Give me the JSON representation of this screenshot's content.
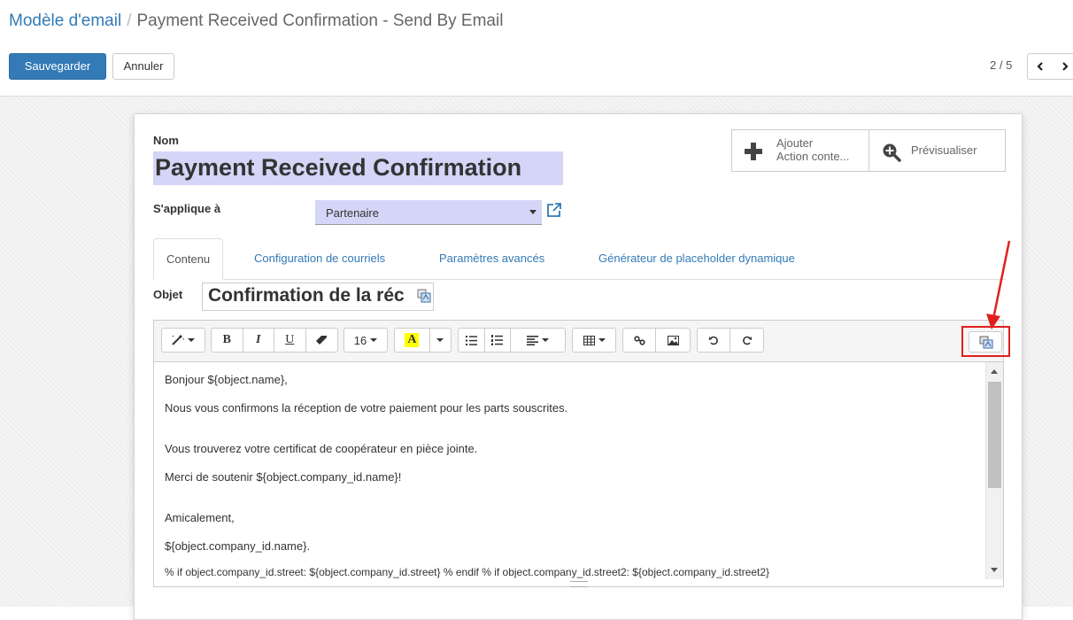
{
  "breadcrumb": {
    "parent": "Modèle d'email",
    "separator": "/",
    "current": "Payment Received Confirmation - Send By Email"
  },
  "actions": {
    "save_label": "Sauvegarder",
    "cancel_label": "Annuler"
  },
  "pager": {
    "value": "2 / 5"
  },
  "form": {
    "name_label": "Nom",
    "name_value": "Payment Received Confirmation",
    "smart_buttons": {
      "add_action_line1": "Ajouter",
      "add_action_line2": "Action conte...",
      "preview_label": "Prévisualiser"
    },
    "applies_label": "S'applique à",
    "applies_value": "Partenaire",
    "tabs": [
      {
        "label": "Contenu",
        "active": true
      },
      {
        "label": "Configuration de courriels",
        "active": false
      },
      {
        "label": "Paramètres avancés",
        "active": false
      },
      {
        "label": "Générateur de placeholder dynamique",
        "active": false
      }
    ],
    "subject_label": "Objet",
    "subject_value": "Confirmation de la réc"
  },
  "editor": {
    "toolbar": {
      "font_size": "16"
    },
    "body_lines": [
      "Bonjour ${object.name},",
      "Nous vous confirmons la réception de votre paiement pour les parts souscrites.",
      "Vous trouverez votre certificat de coopérateur en pièce jointe.",
      "Merci de soutenir ${object.company_id.name}!",
      "Amicalement,",
      "${object.company_id.name}.",
      "% if object.company_id.street: ${object.company_id.street} % endif % if object.company_id.street2: ${object.company_id.street2}"
    ]
  },
  "colors": {
    "primary": "#337ab7",
    "highlight": "#d5d5f7",
    "annotation": "#e0201b",
    "accent_yellow": "#ffff00"
  }
}
